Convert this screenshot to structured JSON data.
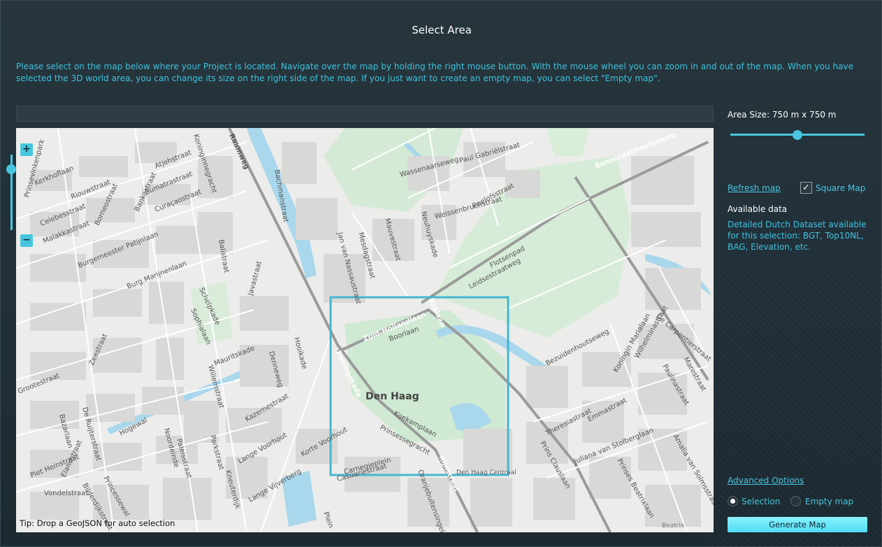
{
  "dialog": {
    "title": "Select Area",
    "instructions": "Please select on the map below where your Project is located. Navigate over the map by holding the right mouse button. With the mouse wheel you can zoom in and out of the map. When you have selected the 3D world area, you can change its size on the right side of the map. If you just want to create an empty map, you can select \"Empty map\"."
  },
  "map": {
    "zoom_in": "+",
    "zoom_out": "−",
    "zoom_level_fraction": 0.85,
    "tip": "Tip: Drop a GeoJSON for auto selection",
    "attribution": "Beatrix",
    "city_label": "Den Haag",
    "streets": [
      "Kerkhoflaan",
      "Riouwstraat",
      "Atjehstraat",
      "Sumatrastraat",
      "Curaçaostraat",
      "Celebesstraat",
      "Malakkastraat",
      "Borneostraat",
      "Bankastraat",
      "Burgemeester Patijnlaan",
      "Burg.Marijnenlaan",
      "Javastraat",
      "Balistraat",
      "Bachmanstraat",
      "Koninginnegracht",
      "Raamweg",
      "Wassenaarseweg",
      "Paul Gabriëlstraat",
      "Benoordenhoutseweg",
      "Weissenbruchstraat",
      "Roelofsstraat",
      "Neuhuyskade",
      "Mauvestraat",
      "Mesdagstraat",
      "Jan van Nassaustraat",
      "Zuid-Hollandlaan",
      "Boslaan",
      "Boorlaan",
      "Leidsestraatweg",
      "Flotsenpad",
      "Zeestraat",
      "De Ruijterstraat",
      "Bazarlaan",
      "Hogewal",
      "Mauritskade",
      "Denneweg",
      "Hooikade",
      "Willemstraat",
      "Kazernestraat",
      "Parkstraat",
      "Noordeinde",
      "Lange Voorhout",
      "Korte Voorhout",
      "Lange Vijverberg",
      "Koekamplaan",
      "Prinsessegracht",
      "Rijnstraat",
      "Oranjebuitensingel",
      "Koningskade",
      "Bezuidenhoutseweg",
      "Theresiastraat",
      "Emmastraat",
      "Prins Clauslaan",
      "Juliana van Stolberglaan",
      "Prinses Beatrixlaan",
      "Prinsevinkenpark",
      "Piet Heinstraat",
      "Elandstraat",
      "Vondelstraat",
      "Bilderdijkstraat",
      "Schelpkade",
      "Sophialaan",
      "Koningin Marialaan",
      "Wilhelminastraat",
      "Paulinastraat",
      "Marestraat",
      "De Carpentierstraat",
      "Amalia van Solmsstraat",
      "Plein",
      "Carnegieplein",
      "Casuariestraat",
      "Grootestraat",
      "Princessewal",
      "Paleisstraat",
      "Kneuterdijk"
    ],
    "station_label": "Den Haag Centraal"
  },
  "sidebar": {
    "area_size_label": "Area Size: 750 m x 750 m",
    "area_size_fraction": 0.5,
    "refresh_link": "Refresh map",
    "square_map_label": "Square Map",
    "square_map_checked": true,
    "checkmark": "✓",
    "available_title": "Available data",
    "available_text": "Detailed Dutch Dataset available for this selection: BGT, Top10NL, BAG, Elevation, etc.",
    "advanced_link": "Advanced Options",
    "mode_options": [
      "Selection",
      "Empty map"
    ],
    "selected_mode": "Selection",
    "generate_button": "Generate Map"
  },
  "colors": {
    "accent": "#48c6df",
    "selection_box": "#43b7cf",
    "park": "#cfe9d3",
    "water": "#a9d7ec"
  }
}
